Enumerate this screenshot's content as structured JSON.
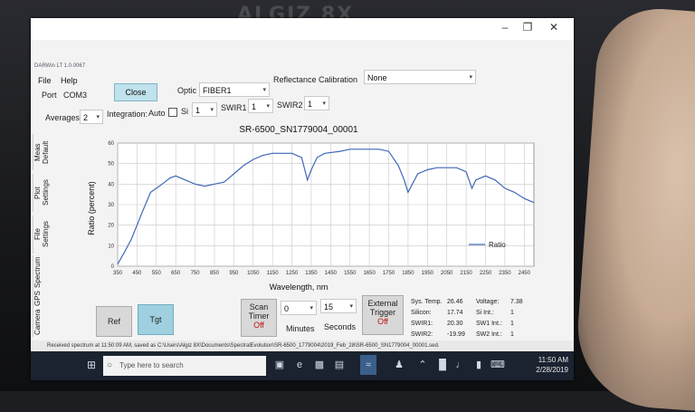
{
  "device": {
    "brand": "ALGIZ 8X"
  },
  "window": {
    "app_name": "DARWin LT 1.0.0067",
    "menu": [
      "File",
      "Help"
    ],
    "port_label": "Port",
    "port_value": "COM3",
    "close_label": "Close",
    "optic_label": "Optic",
    "optic_value": "FIBER1",
    "reflectance_label": "Reflectance Calibration",
    "reflectance_value": "None",
    "averages_label": "Averages",
    "averages_value": "2",
    "integration_label": "Integration:",
    "auto_label": "Auto",
    "si_label": "Si",
    "si_value": "1",
    "swir1_label": "SWIR1",
    "swir1_value": "1",
    "swir2_label": "SWIR2",
    "swir2_value": "1"
  },
  "side_tabs": [
    "Meas Default",
    "Plot Settings",
    "File Settings",
    "Spectrum",
    "GPS",
    "Camera"
  ],
  "chart_data": {
    "type": "line",
    "title": "SR-6500_SN1779004_00001",
    "xlabel": "Wavelength, nm",
    "ylabel": "Ratio (percent)",
    "xlim": [
      350,
      2500
    ],
    "ylim": [
      0,
      60
    ],
    "grid": true,
    "legend": "bottom-right",
    "x_ticks": [
      350,
      450,
      550,
      650,
      750,
      850,
      950,
      1050,
      1150,
      1250,
      1350,
      1450,
      1550,
      1650,
      1750,
      1850,
      1950,
      2050,
      2150,
      2250,
      2350,
      2450
    ],
    "y_ticks": [
      0,
      10,
      20,
      30,
      40,
      50,
      60
    ],
    "series": [
      {
        "name": "Ratio",
        "color": "#3f67b8",
        "x": [
          350,
          380,
          420,
          450,
          480,
          520,
          550,
          580,
          620,
          650,
          700,
          750,
          800,
          850,
          900,
          950,
          1000,
          1050,
          1100,
          1150,
          1200,
          1250,
          1300,
          1330,
          1350,
          1380,
          1420,
          1500,
          1550,
          1600,
          1650,
          1700,
          1750,
          1800,
          1830,
          1850,
          1900,
          1950,
          2000,
          2050,
          2100,
          2150,
          2180,
          2200,
          2250,
          2300,
          2350,
          2400,
          2450,
          2500
        ],
        "values": [
          1,
          6,
          13,
          20,
          27,
          36,
          38,
          40,
          43,
          44,
          42,
          40,
          39,
          40,
          41,
          45,
          49,
          52,
          54,
          55,
          55,
          55,
          53,
          42,
          47,
          53,
          55,
          56,
          57,
          57,
          57,
          57,
          56,
          49,
          42,
          36,
          45,
          47,
          48,
          48,
          48,
          46,
          38,
          42,
          44,
          42,
          38,
          36,
          33,
          31
        ]
      }
    ]
  },
  "buttons": {
    "ref": "Ref",
    "tgt": "Tgt",
    "scan_timer": "Scan Timer",
    "scan_timer_state": "Off",
    "minutes_value": "0",
    "minutes_label": "Minutes",
    "seconds_value": "15",
    "seconds_label": "Seconds",
    "external_trigger": "External Trigger",
    "external_trigger_state": "Off"
  },
  "status": {
    "sys_temp_label": "Sys. Temp.",
    "sys_temp": "26.46",
    "voltage_label": "Voltage:",
    "voltage": "7.38",
    "silicon_label": "Silicon:",
    "silicon": "17.74",
    "si_int_label": "Si Int.:",
    "si_int": "1",
    "swir1_label": "SWIR1:",
    "swir1": "20.30",
    "sw1_int_label": "SW1 Int.:",
    "sw1_int": "1",
    "swir2_label": "SWIR2:",
    "swir2": "-19.99",
    "sw2_int_label": "SW2 Int.:",
    "sw2_int": "1"
  },
  "statusbar_text": "Received spectrum at 11:50:09 AM, saved as C:\\Users\\Algiz 8X\\Documents\\SpectralEvolution\\SR-6500_1779004\\2019_Feb_28\\SR-6500_SN1779004_00001.sed.",
  "taskbar": {
    "search_placeholder": "Type here to search",
    "time": "11:50 AM",
    "date": "2/28/2019"
  }
}
